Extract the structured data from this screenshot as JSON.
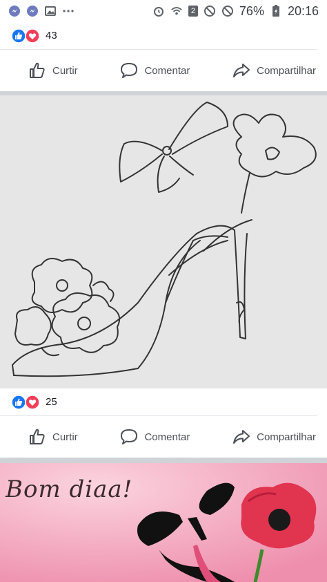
{
  "status_bar": {
    "battery_percent": "76%",
    "time": "20:16",
    "sim_badge": "2"
  },
  "posts": [
    {
      "reaction_count": "43",
      "actions": {
        "like": "Curtir",
        "comment": "Comentar",
        "share": "Compartilhar"
      }
    },
    {
      "reaction_count": "25",
      "actions": {
        "like": "Curtir",
        "comment": "Comentar",
        "share": "Compartilhar"
      }
    }
  ],
  "bottom_image": {
    "caption": "Bom diaa!"
  },
  "colors": {
    "like_blue": "#1877f2",
    "love_red": "#f33e58",
    "action_gray": "#4b4f56"
  }
}
